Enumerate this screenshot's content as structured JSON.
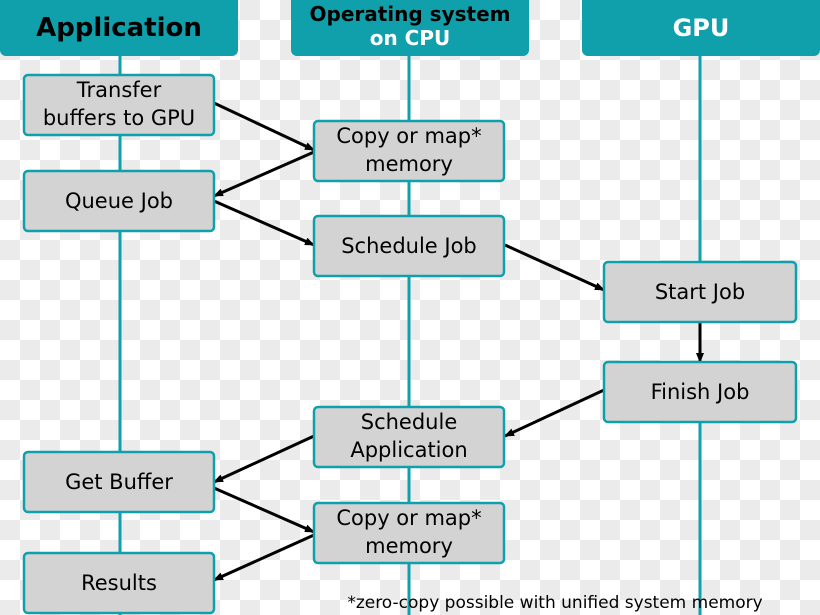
{
  "colors": {
    "teal": "#0fa0ab",
    "box_fill": "#d3d3d3",
    "arrow": "#000000",
    "checker_light": "#ffffff",
    "checker_dark": "#ebebeb"
  },
  "lanes": [
    {
      "title": [
        "Application"
      ]
    },
    {
      "title": [
        "Operating system",
        "on CPU"
      ]
    },
    {
      "title": [
        "GPU"
      ]
    }
  ],
  "steps": [
    {
      "label": [
        "Transfer",
        "buffers to GPU"
      ]
    },
    {
      "label": [
        "Copy or map*",
        "memory"
      ]
    },
    {
      "label": [
        "Queue Job"
      ]
    },
    {
      "label": [
        "Schedule Job"
      ]
    },
    {
      "label": [
        "Start Job"
      ]
    },
    {
      "label": [
        "Finish Job"
      ]
    },
    {
      "label": [
        "Schedule",
        "Application"
      ]
    },
    {
      "label": [
        "Get Buffer"
      ]
    },
    {
      "label": [
        "Copy or map*",
        "memory"
      ]
    },
    {
      "label": [
        "Results"
      ]
    }
  ],
  "footnote": "*zero-copy possible with unified system memory"
}
